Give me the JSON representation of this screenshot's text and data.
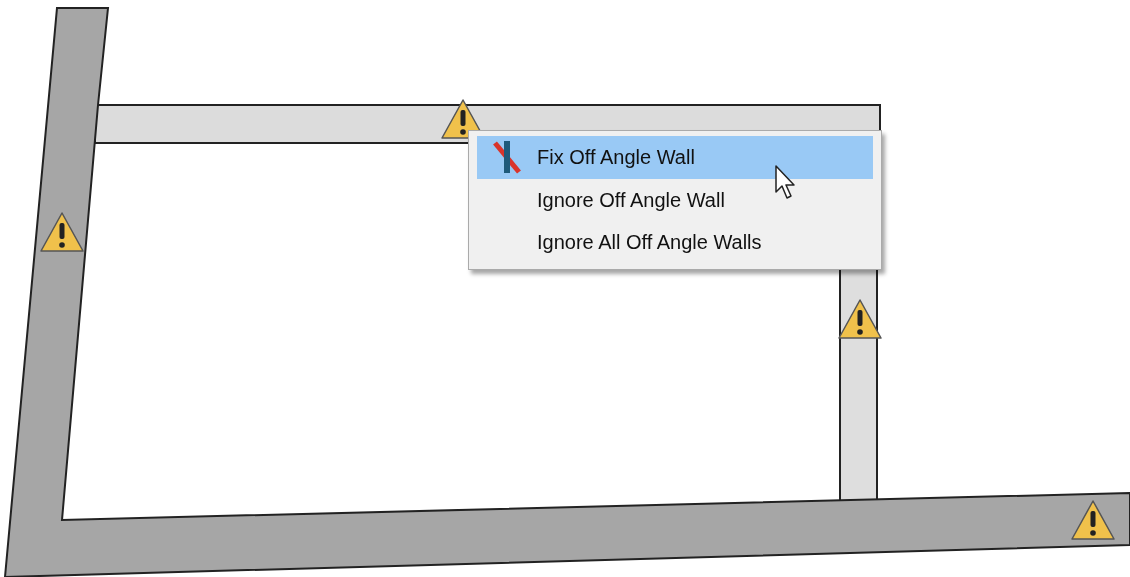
{
  "context_menu": {
    "items": [
      {
        "label": "Fix Off Angle Wall",
        "selected": true,
        "has_icon": true
      },
      {
        "label": "Ignore Off Angle Wall",
        "selected": false,
        "has_icon": false
      },
      {
        "label": "Ignore All Off Angle Walls",
        "selected": false,
        "has_icon": false
      }
    ]
  }
}
